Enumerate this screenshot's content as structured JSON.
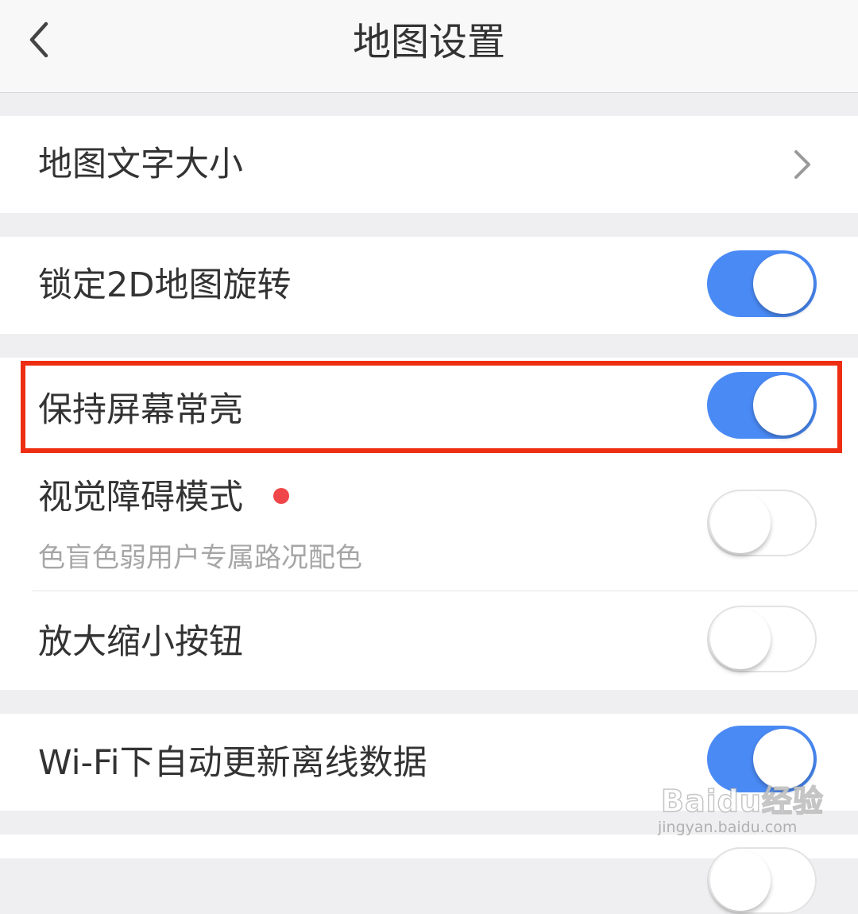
{
  "header": {
    "title": "地图设置",
    "back_icon": "chevron-left-icon"
  },
  "settings": {
    "map_text_size": {
      "label": "地图文字大小",
      "icon": "chevron-right-icon"
    },
    "lock_2d_rotation": {
      "label": "锁定2D地图旋转",
      "enabled": true
    },
    "keep_screen_on": {
      "label": "保持屏幕常亮",
      "enabled": true
    },
    "visual_impairment_mode": {
      "label": "视觉障碍模式",
      "subtitle": "色盲色弱用户专属路况配色",
      "enabled": false,
      "new_badge": "red-dot"
    },
    "zoom_buttons": {
      "label": "放大缩小按钮",
      "enabled": false
    },
    "wifi_auto_update": {
      "label": "Wi-Fi下自动更新离线数据",
      "enabled": true
    }
  },
  "watermark": {
    "brand": "Baidu经验",
    "url": "jingyan.baidu.com"
  },
  "colors": {
    "toggle_on": "#4a8af5",
    "highlight_border": "#ee2e12",
    "badge_dot": "#f0464a",
    "background": "#efeff1"
  }
}
